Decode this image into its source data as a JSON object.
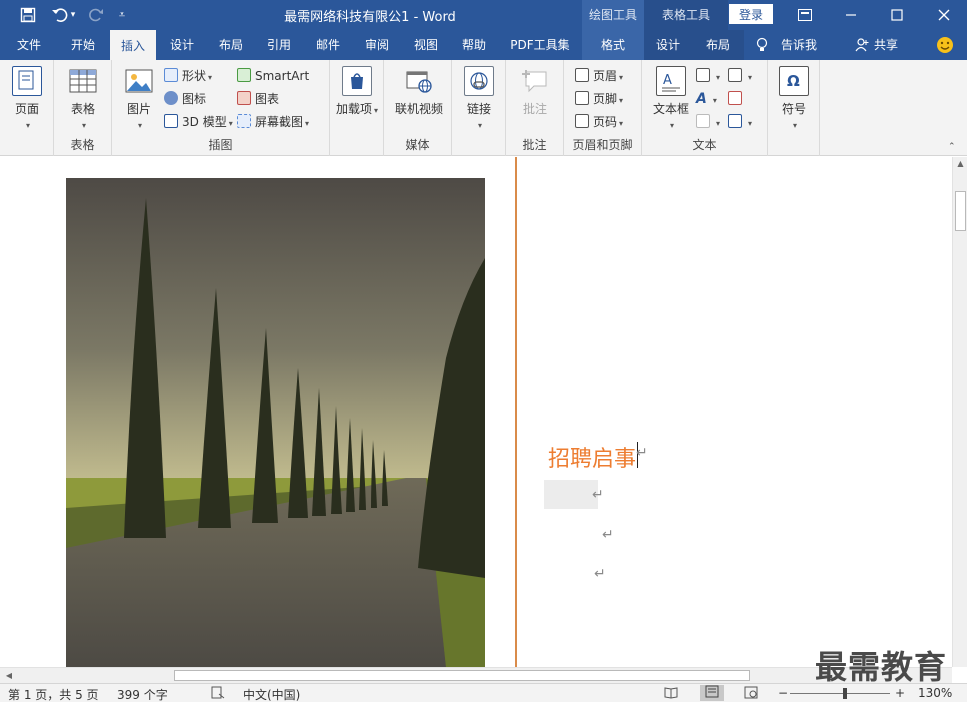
{
  "title_bar": {
    "doc_title": "最需网络科技有限公1  -  Word",
    "context_tab_drawing": "绘图工具",
    "context_tab_table": "表格工具",
    "login_label": "登录",
    "window_buttons": [
      "restore-ribbon",
      "minimize",
      "maximize",
      "close"
    ]
  },
  "tabs": [
    {
      "label": "文件"
    },
    {
      "label": "开始"
    },
    {
      "label": "插入"
    },
    {
      "label": "设计"
    },
    {
      "label": "布局"
    },
    {
      "label": "引用"
    },
    {
      "label": "邮件"
    },
    {
      "label": "审阅"
    },
    {
      "label": "视图"
    },
    {
      "label": "帮助"
    },
    {
      "label": "PDF工具集"
    },
    {
      "label": "格式"
    },
    {
      "label": "设计"
    },
    {
      "label": "布局"
    },
    {
      "label": "告诉我"
    },
    {
      "label": "共享"
    }
  ],
  "active_tab": "插入",
  "ribbon": {
    "pages": {
      "btn": "页面",
      "label": ""
    },
    "tables": {
      "btn": "表格",
      "label": "表格"
    },
    "illustrations": {
      "picture": "图片",
      "shapes": "形状",
      "icons": "图标",
      "model3d": "3D 模型",
      "smartart": "SmartArt",
      "chart": "图表",
      "screenshot": "屏幕截图",
      "label": "插图"
    },
    "addins": {
      "btn": "加载项"
    },
    "media": {
      "btn": "联机视频",
      "label": "媒体"
    },
    "links": {
      "btn": "链接"
    },
    "comments": {
      "btn": "批注",
      "label": "批注"
    },
    "header_footer": {
      "header": "页眉",
      "footer": "页脚",
      "page_number": "页码",
      "label": "页眉和页脚"
    },
    "text": {
      "textbox": "文本框",
      "label": "文本"
    },
    "symbols": {
      "btn": "符号"
    }
  },
  "document": {
    "heading": "招聘启事",
    "para_mark": "↵"
  },
  "watermark": "最需教育",
  "status_bar": {
    "page": "第 1 页，共 5 页",
    "words": "399 个字",
    "language": "中文(中国)",
    "zoom": "130%"
  },
  "colors": {
    "brand": "#2b579a",
    "heading": "#ed7d31",
    "column_line": "#d98b4a"
  }
}
